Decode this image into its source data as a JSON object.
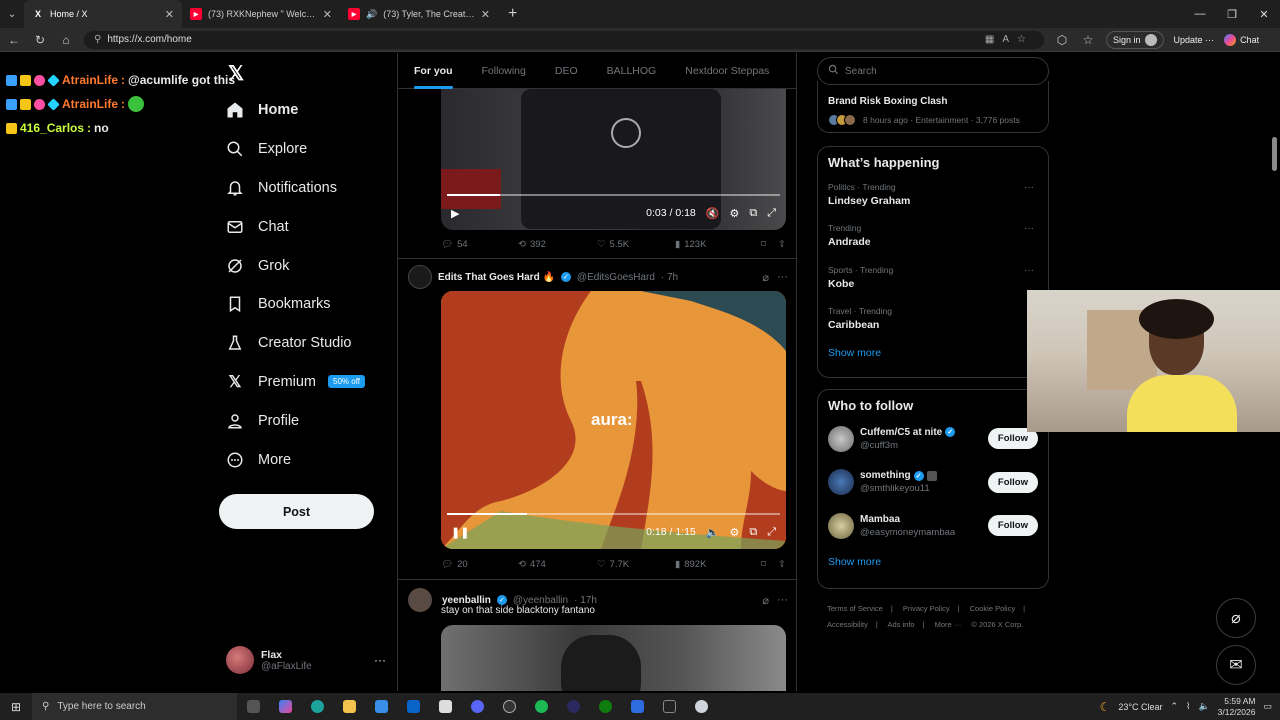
{
  "browser": {
    "tabs": [
      {
        "title": "Home / X",
        "fav": "X"
      },
      {
        "title": "(73) RXKNephew \" Welcome 2 The",
        "fav": "▶"
      },
      {
        "title": "(73) Tyler, The Creator - I'll Tak",
        "fav": "▶"
      }
    ],
    "url": "https://x.com/home",
    "signin": "Sign in",
    "update": "Update",
    "chat": "Chat"
  },
  "stream_chat": [
    {
      "user": "AtrainLife",
      "message": "@acumlife got this"
    },
    {
      "user": "AtrainLife",
      "message": ""
    },
    {
      "user": "416_Carlos",
      "message": "no"
    }
  ],
  "nav": {
    "items": [
      {
        "label": "Home",
        "icon": "home-icon"
      },
      {
        "label": "Explore",
        "icon": "search-icon"
      },
      {
        "label": "Notifications",
        "icon": "bell-icon"
      },
      {
        "label": "Chat",
        "icon": "mail-icon"
      },
      {
        "label": "Grok",
        "icon": "grok-icon"
      },
      {
        "label": "Bookmarks",
        "icon": "bookmark-icon"
      },
      {
        "label": "Creator Studio",
        "icon": "flask-icon"
      },
      {
        "label": "Premium",
        "icon": "x-icon"
      },
      {
        "label": "Profile",
        "icon": "person-icon"
      },
      {
        "label": "More",
        "icon": "more-circle-icon"
      }
    ],
    "premium_promo": "50% off",
    "post_label": "Post",
    "account": {
      "name": "Flax",
      "handle": "@aFlaxLife"
    }
  },
  "feed": {
    "tabs": [
      "For you",
      "Following",
      "DEO",
      "BALLHOG",
      "Nextdoor Steppas"
    ],
    "tweet1": {
      "video_time": "0:03 / 0:18",
      "video_progress": 0.16,
      "replies": "54",
      "reposts": "392",
      "likes": "5.5K",
      "views": "123K"
    },
    "tweet2": {
      "name": "Edits That Goes Hard 🔥",
      "handle": "@EditsGoesHard",
      "time": "· 7h",
      "overlay_text": "aura:",
      "video_time": "0:18 / 1:15",
      "video_progress": 0.24,
      "replies": "20",
      "reposts": "474",
      "likes": "7.7K",
      "views": "892K"
    },
    "tweet3": {
      "name": "yeenballin",
      "handle": "@yeenballin",
      "time": "· 17h",
      "text": "stay on that side blacktony fantano"
    }
  },
  "right": {
    "search_placeholder": "Search",
    "top_trend": {
      "title": "Brand Risk Boxing Clash",
      "meta": "8 hours ago · Entertainment · 3,776 posts"
    },
    "whats_happening": {
      "title": "What’s happening",
      "trends": [
        {
          "category": "Politics · Trending",
          "name": "Lindsey Graham"
        },
        {
          "category": "Trending",
          "name": "Andrade"
        },
        {
          "category": "Sports · Trending",
          "name": "Kobe"
        },
        {
          "category": "Travel · Trending",
          "name": "Caribbean"
        }
      ],
      "show_more": "Show more"
    },
    "who_to_follow": {
      "title": "Who to follow",
      "accounts": [
        {
          "name": "Cuffem/C5 at nite",
          "handle": "@cuff3m",
          "button": "Follow"
        },
        {
          "name": "something",
          "handle": "@smthlikeyou11",
          "button": "Follow"
        },
        {
          "name": "Mambaa",
          "handle": "@easymoneymambaa",
          "button": "Follow"
        }
      ],
      "show_more": "Show more"
    },
    "footer": [
      "Terms of Service",
      "|",
      "Privacy Policy",
      "|",
      "Cookie Policy",
      "|",
      "Accessibility",
      "|",
      "Ads info",
      "|",
      "More ···",
      "© 2026 X Corp."
    ]
  },
  "taskbar": {
    "search_placeholder": "Type here to search",
    "weather": "23°C  Clear",
    "time": "5:59 AM",
    "date": "3/12/2026"
  }
}
